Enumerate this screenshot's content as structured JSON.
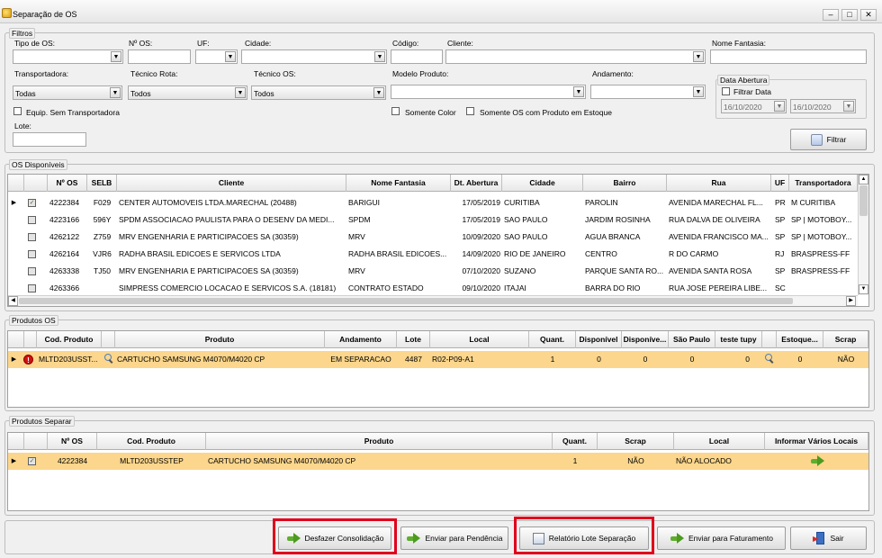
{
  "window": {
    "title": "Separação de OS",
    "minimize": "–",
    "maximize": "□",
    "close": "✕"
  },
  "filtros": {
    "legend": "Filtros",
    "tipo_os_label": "Tipo de OS:",
    "tipo_os_value": "",
    "num_os_label": "Nº OS:",
    "num_os_value": "",
    "uf_label": "UF:",
    "uf_value": "",
    "cidade_label": "Cidade:",
    "cidade_value": "",
    "codigo_label": "Código:",
    "codigo_value": "",
    "cliente_label": "Cliente:",
    "cliente_value": "",
    "nome_fantasia_label": "Nome Fantasia:",
    "nome_fantasia_value": "",
    "transportadora_label": "Transportadora:",
    "transportadora_value": "Todas",
    "tecnico_rota_label": "Técnico Rota:",
    "tecnico_rota_value": "Todos",
    "tecnico_os_label": "Técnico OS:",
    "tecnico_os_value": "Todos",
    "modelo_produto_label": "Modelo Produto:",
    "modelo_produto_value": "",
    "andamento_label": "Andamento:",
    "andamento_value": "",
    "data_abertura_legend": "Data Abertura",
    "filtrar_data_label": "Filtrar Data",
    "data_inicio": "16/10/2020",
    "data_fim": "16/10/2020",
    "equip_sem_transp_label": "Equip. Sem Transportadora",
    "somente_color_label": "Somente Color",
    "somente_os_estoque_label": "Somente OS com Produto em Estoque",
    "lote_label": "Lote:",
    "lote_value": "",
    "filtrar_button": "Filtrar"
  },
  "os_disponiveis": {
    "legend": "OS Disponíveis",
    "columns": [
      "Nº OS",
      "SELB",
      "Cliente",
      "Nome Fantasia",
      "Dt. Abertura",
      "Cidade",
      "Bairro",
      "Rua",
      "UF",
      "Transportadora"
    ],
    "rows": [
      {
        "checked": true,
        "os": "4222384",
        "selb": "F029",
        "cliente": "CENTER AUTOMOVEIS LTDA.MARECHAL (20488)",
        "fantasia": "BARIGUI",
        "dt": "17/05/2019",
        "cidade": "CURITIBA",
        "bairro": "PAROLIN",
        "rua": "AVENIDA  MARECHAL  FL...",
        "uf": "PR",
        "transp": "M CURITIBA"
      },
      {
        "checked": false,
        "os": "4223166",
        "selb": "596Y",
        "cliente": "SPDM ASSOCIACAO PAULISTA PARA O DESENV DA MEDI...",
        "fantasia": "SPDM",
        "dt": "17/05/2019",
        "cidade": "SAO PAULO",
        "bairro": "JARDIM ROSINHA",
        "rua": "RUA DALVA DE OLIVEIRA",
        "uf": "SP",
        "transp": "SP | MOTOBOY..."
      },
      {
        "checked": false,
        "os": "4262122",
        "selb": "Z759",
        "cliente": "MRV ENGENHARIA E PARTICIPACOES SA  (30359)",
        "fantasia": "MRV",
        "dt": "10/09/2020",
        "cidade": "SAO PAULO",
        "bairro": "AGUA BRANCA",
        "rua": "AVENIDA FRANCISCO MA...",
        "uf": "SP",
        "transp": "SP | MOTOBOY..."
      },
      {
        "checked": false,
        "os": "4262164",
        "selb": "VJR6",
        "cliente": "RADHA BRASIL EDICOES E SERVICOS LTDA",
        "fantasia": "RADHA BRASIL EDICOES...",
        "dt": "14/09/2020",
        "cidade": "RIO DE JANEIRO",
        "bairro": "CENTRO",
        "rua": "R DO CARMO",
        "uf": "RJ",
        "transp": "BRASPRESS-FF"
      },
      {
        "checked": false,
        "os": "4263338",
        "selb": "TJ50",
        "cliente": "MRV ENGENHARIA E PARTICIPACOES SA  (30359)",
        "fantasia": "MRV",
        "dt": "07/10/2020",
        "cidade": "SUZANO",
        "bairro": "PARQUE  SANTA  RO...",
        "rua": "AVENIDA SANTA ROSA",
        "uf": "SP",
        "transp": "BRASPRESS-FF"
      },
      {
        "checked": false,
        "os": "4263366",
        "selb": "",
        "cliente": "SIMPRESS COMERCIO LOCACAO E SERVICOS S.A. (18181)",
        "fantasia": "CONTRATO ESTADO",
        "dt": "09/10/2020",
        "cidade": "ITAJAI",
        "bairro": "BARRA DO RIO",
        "rua": "RUA JOSE PEREIRA LIBE...",
        "uf": "SC",
        "transp": ""
      }
    ]
  },
  "produtos_os": {
    "legend": "Produtos OS",
    "columns": [
      "Cod. Produto",
      "Produto",
      "Andamento",
      "Lote",
      "Local",
      "Quant.",
      "Disponível",
      "Disponíve...",
      "São Paulo",
      "teste tupy",
      "Estoque...",
      "Scrap"
    ],
    "rows": [
      {
        "cod": "MLTD203USST...",
        "produto": "CARTUCHO SAMSUNG M4070/M4020 CP",
        "andamento": "EM SEPARACAO",
        "lote": "4487",
        "local": "R02-P09-A1",
        "quant": "1",
        "disp1": "0",
        "disp2": "0",
        "sao_paulo": "0",
        "teste_tupy": "0",
        "estoque": "0",
        "scrap": "NÃO"
      }
    ]
  },
  "produtos_separar": {
    "legend": "Produtos Separar",
    "columns": [
      "Nº OS",
      "Cod. Produto",
      "Produto",
      "Quant.",
      "Scrap",
      "Local",
      "Informar Vários Locais"
    ],
    "rows": [
      {
        "checked": true,
        "os": "4222384",
        "cod": "MLTD203USSTEP",
        "produto": "CARTUCHO SAMSUNG M4070/M4020 CP",
        "quant": "1",
        "scrap": "NÃO",
        "local": "NÃO ALOCADO"
      }
    ]
  },
  "footer": {
    "desfazer": "Desfazer Consolidação",
    "pendencia": "Enviar para Pendência",
    "relatorio": "Relatório Lote Separação",
    "faturamento": "Enviar para Faturamento",
    "sair": "Sair"
  },
  "colors": {
    "selected_row": "#fbd68c",
    "highlight": "#e0001b"
  }
}
